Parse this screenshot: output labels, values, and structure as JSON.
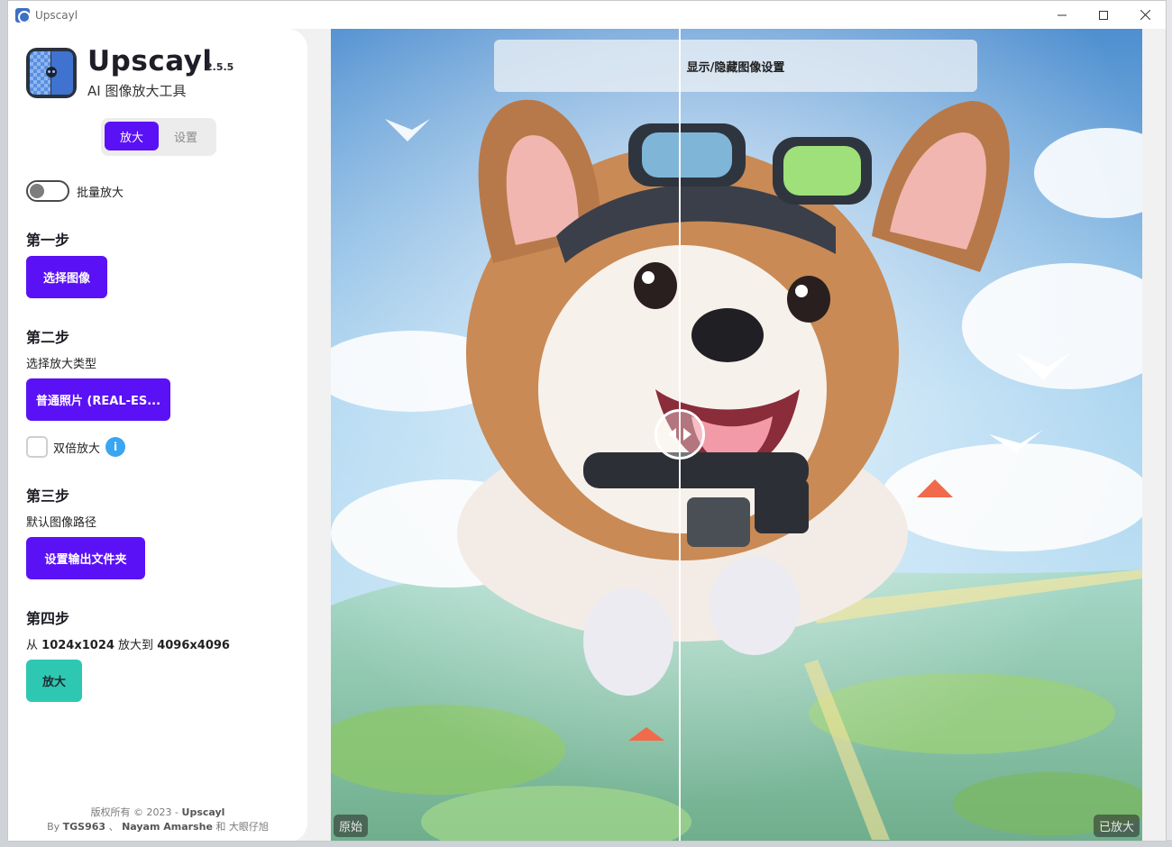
{
  "window": {
    "title": "Upscayl",
    "minimize_icon": "minimize-icon",
    "maximize_icon": "maximize-icon",
    "close_icon": "close-icon"
  },
  "sidebar": {
    "app_name": "Upscayl",
    "version": "2.5.5",
    "subtitle": "AI 图像放大工具",
    "tabs": [
      {
        "label": "放大",
        "active": true
      },
      {
        "label": "设置",
        "active": false
      }
    ],
    "batch_toggle": {
      "label": "批量放大",
      "on": false
    },
    "step1": {
      "title": "第一步",
      "button": "选择图像"
    },
    "step2": {
      "title": "第二步",
      "description": "选择放大类型",
      "button": "普通照片 (REAL-ES...",
      "double_upscale_label": "双倍放大",
      "double_upscale_checked": false,
      "info_icon": "i"
    },
    "step3": {
      "title": "第三步",
      "description": "默认图像路径",
      "button": "设置输出文件夹"
    },
    "step4": {
      "title": "第四步",
      "prefix": "从",
      "from_size": "1024x1024",
      "middle": "放大到",
      "to_size": "4096x4096",
      "button": "放大"
    },
    "footer": {
      "line1_prefix": "版权所有 © 2023 -",
      "line1_brand": "Upscayl",
      "line2_by": "By",
      "author1": "TGS963",
      "sep": "、",
      "author2": "Nayam Amarshe",
      "and": "和",
      "author3": "大眼仔旭"
    }
  },
  "viewer": {
    "toggle_settings_label": "显示/隐藏图像设置",
    "original_label": "原始",
    "upscaled_label": "已放大",
    "slider_position": 0.43
  },
  "colors": {
    "accent": "#5b11f5",
    "upscale_button": "#2ec8b2",
    "info": "#3aa6f2"
  }
}
